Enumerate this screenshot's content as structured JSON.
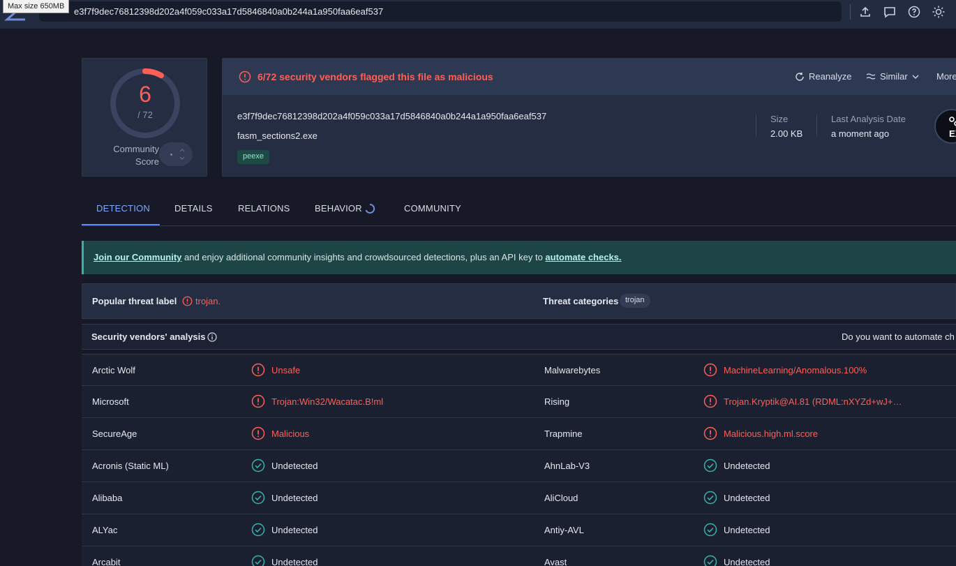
{
  "tooltip": "Max size 650MB",
  "search": {
    "value": "e3f7f9dec76812398d202a4f059c033a17d5846840a0b244a1a950faa6eaf537"
  },
  "toolbar_icons": [
    "upload-icon",
    "comment-icon",
    "help-icon",
    "theme-icon"
  ],
  "score": {
    "detections": "6",
    "total": "/ 72",
    "community_label_1": "Community",
    "community_label_2": "Score",
    "detection_fraction": 0.083
  },
  "header": {
    "alert": "6/72 security vendors flagged this file as malicious",
    "actions": {
      "reanalyze": "Reanalyze",
      "similar": "Similar",
      "more": "More"
    },
    "hash": "e3f7f9dec76812398d202a4f059c033a17d5846840a0b244a1a950faa6eaf537",
    "filename": "fasm_sections2.exe",
    "tag": "peexe",
    "size_label": "Size",
    "size_value": "2.00 KB",
    "last_analysis_label": "Last Analysis Date",
    "last_analysis_value": "a moment ago",
    "filetype_badge": "EX"
  },
  "tabs": [
    "DETECTION",
    "DETAILS",
    "RELATIONS",
    "BEHAVIOR",
    "COMMUNITY"
  ],
  "banner": {
    "link1": "Join our Community",
    "middle": " and enjoy additional community insights and crowdsourced detections, plus an API key to ",
    "link2": "automate checks."
  },
  "threat": {
    "popular_label": "Popular threat label",
    "popular_value": "trojan.",
    "categories_label": "Threat categories",
    "category": "trojan"
  },
  "vendors": {
    "title": "Security vendors' analysis",
    "automate_prompt": "Do you want to automate ch",
    "rows": [
      {
        "left_vendor": "Arctic Wolf",
        "left_result": "Unsafe",
        "left_malicious": true,
        "right_vendor": "Malwarebytes",
        "right_result": "MachineLearning/Anomalous.100%",
        "right_malicious": true
      },
      {
        "left_vendor": "Microsoft",
        "left_result": "Trojan:Win32/Wacatac.B!ml",
        "left_malicious": true,
        "right_vendor": "Rising",
        "right_result": "Trojan.Kryptik@AI.81 (RDML:nXYZd+wJ+…",
        "right_malicious": true
      },
      {
        "left_vendor": "SecureAge",
        "left_result": "Malicious",
        "left_malicious": true,
        "right_vendor": "Trapmine",
        "right_result": "Malicious.high.ml.score",
        "right_malicious": true
      },
      {
        "left_vendor": "Acronis (Static ML)",
        "left_result": "Undetected",
        "left_malicious": false,
        "right_vendor": "AhnLab-V3",
        "right_result": "Undetected",
        "right_malicious": false
      },
      {
        "left_vendor": "Alibaba",
        "left_result": "Undetected",
        "left_malicious": false,
        "right_vendor": "AliCloud",
        "right_result": "Undetected",
        "right_malicious": false
      },
      {
        "left_vendor": "ALYac",
        "left_result": "Undetected",
        "left_malicious": false,
        "right_vendor": "Antiy-AVL",
        "right_result": "Undetected",
        "right_malicious": false
      },
      {
        "left_vendor": "Arcabit",
        "left_result": "Undetected",
        "left_malicious": false,
        "right_vendor": "Avast",
        "right_result": "Undetected",
        "right_malicious": false
      }
    ]
  },
  "colors": {
    "malicious": "#ff5f56",
    "clean": "#37b3a8",
    "accent": "#5b8cff"
  }
}
